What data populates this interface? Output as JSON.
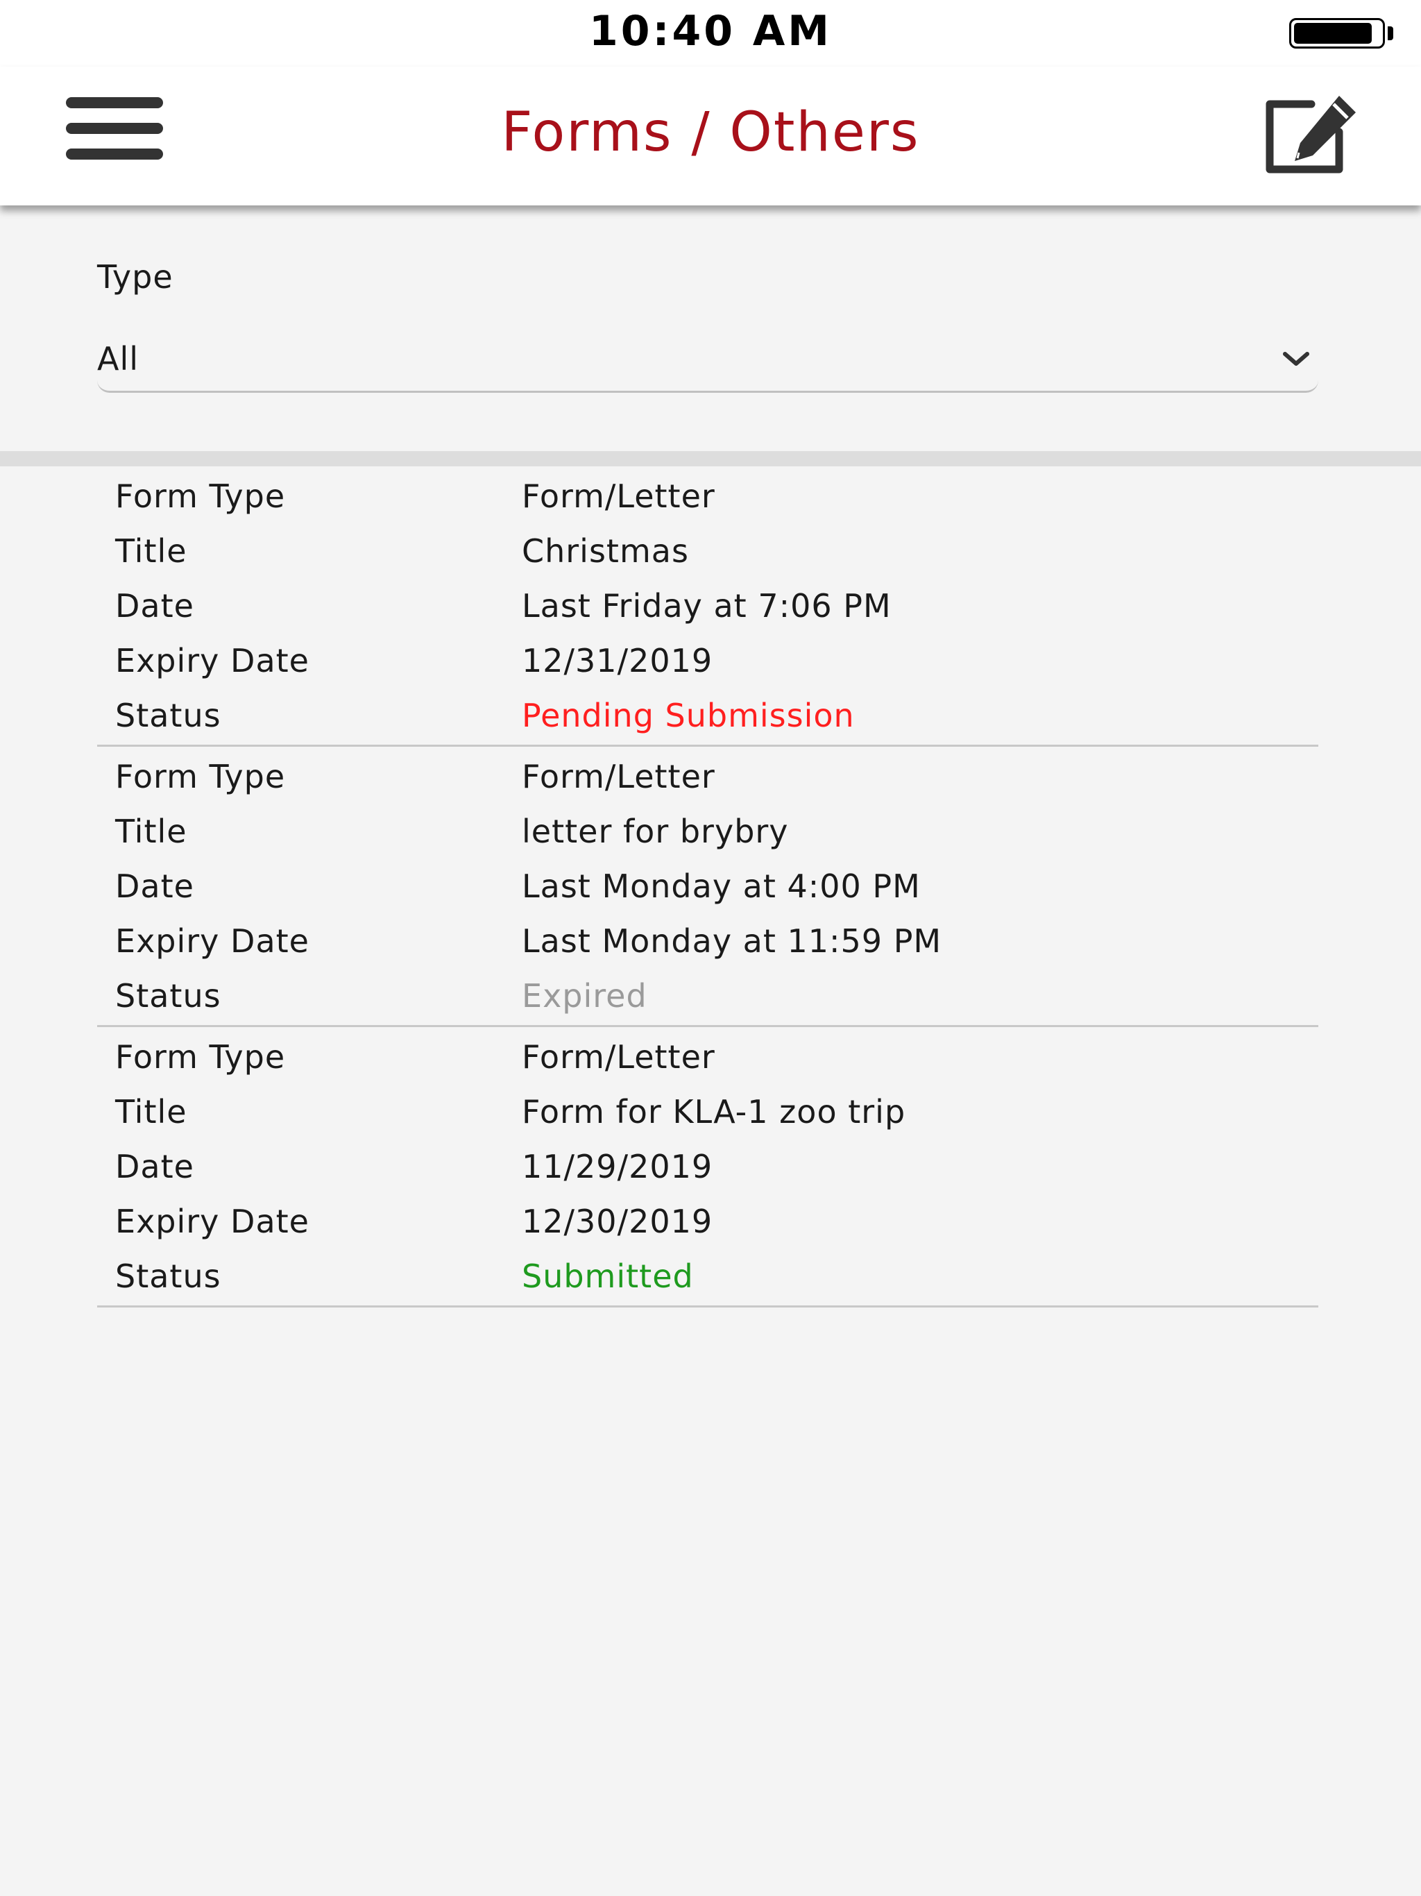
{
  "status_bar": {
    "time": "10:40 AM",
    "battery_level": 0.9
  },
  "nav": {
    "title": "Forms / Others",
    "menu_icon": "hamburger-menu-icon",
    "compose_icon": "compose-edit-icon"
  },
  "filter": {
    "label": "Type",
    "selected": "All"
  },
  "forms": [
    {
      "form_type_label": "Form Type",
      "form_type": "Form/Letter",
      "title_label": "Title",
      "title": "Christmas",
      "date_label": "Date",
      "date": "Last Friday at 7:06 PM",
      "expiry_label": "Expiry Date",
      "expiry": "12/31/2019",
      "status_label": "Status",
      "status": "Pending Submission",
      "status_color": "#ff1f1f"
    },
    {
      "form_type_label": "Form Type",
      "form_type": "Form/Letter",
      "title_label": "Title",
      "title": "letter for brybry",
      "date_label": "Date",
      "date": "Last Monday at 4:00 PM",
      "expiry_label": "Expiry Date",
      "expiry": "Last Monday at 11:59 PM",
      "status_label": "Status",
      "status": "Expired",
      "status_color": "#9a9a9a"
    },
    {
      "form_type_label": "Form Type",
      "form_type": "Form/Letter",
      "title_label": "Title",
      "title": "Form for KLA-1 zoo trip",
      "date_label": "Date",
      "date": "11/29/2019",
      "expiry_label": "Expiry Date",
      "expiry": "12/30/2019",
      "status_label": "Status",
      "status": "Submitted",
      "status_color": "#1e9a1e"
    }
  ]
}
